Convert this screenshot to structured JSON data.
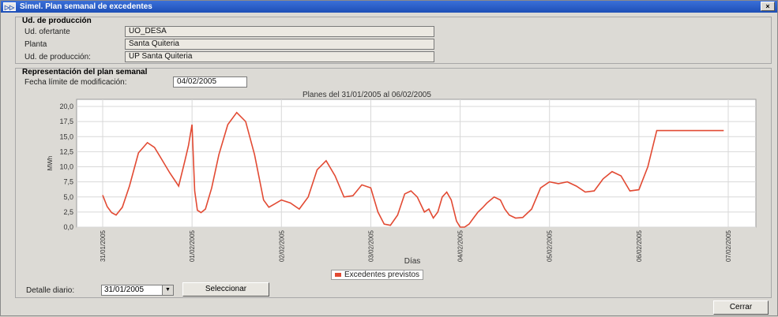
{
  "window": {
    "title": "Simel. Plan semanal de excedentes",
    "close_glyph": "×"
  },
  "unit_group": {
    "title": "Ud. de producción",
    "fields": [
      {
        "label": "Ud. ofertante",
        "value": "UO_DESA"
      },
      {
        "label": "Planta",
        "value": "Santa Quiteria"
      },
      {
        "label": "Ud. de producción:",
        "value": "UP Santa Quiteria"
      }
    ]
  },
  "plan_group": {
    "title": "Representación del plan semanal",
    "deadline_label": "Fecha límite de modificación:",
    "deadline_value": "04/02/2005"
  },
  "chart_data": {
    "type": "line",
    "title": "Planes del 31/01/2005 al 06/02/2005",
    "xlabel": "Días",
    "ylabel": "MWh",
    "ylim": [
      0,
      20
    ],
    "yticks": [
      "0,0",
      "2,5",
      "5,0",
      "7,5",
      "10,0",
      "12,5",
      "15,0",
      "17,5",
      "20,0"
    ],
    "xtick_labels": [
      "31/01/2005",
      "01/02/2005",
      "02/02/2005",
      "03/02/2005",
      "04/02/2005",
      "05/02/2005",
      "06/02/2005",
      "07/02/2005"
    ],
    "xlim": [
      0,
      7
    ],
    "grid": true,
    "legend_position": "bottom-center",
    "series": [
      {
        "name": "Excedentes previstos",
        "color": "#e24a33",
        "x": [
          0.0,
          0.05,
          0.1,
          0.15,
          0.22,
          0.3,
          0.4,
          0.5,
          0.58,
          0.65,
          0.75,
          0.85,
          0.92,
          0.96,
          1.0,
          1.03,
          1.06,
          1.1,
          1.15,
          1.22,
          1.3,
          1.4,
          1.5,
          1.6,
          1.7,
          1.8,
          1.86,
          1.92,
          2.0,
          2.1,
          2.2,
          2.3,
          2.4,
          2.5,
          2.6,
          2.7,
          2.8,
          2.9,
          3.0,
          3.08,
          3.15,
          3.22,
          3.3,
          3.38,
          3.45,
          3.52,
          3.6,
          3.65,
          3.7,
          3.75,
          3.8,
          3.85,
          3.9,
          3.96,
          4.0,
          4.02,
          4.05,
          4.1,
          4.15,
          4.2,
          4.25,
          4.3,
          4.38,
          4.45,
          4.5,
          4.55,
          4.62,
          4.7,
          4.8,
          4.9,
          5.0,
          5.1,
          5.2,
          5.3,
          5.4,
          5.5,
          5.6,
          5.7,
          5.8,
          5.9,
          6.0,
          6.1,
          6.2,
          6.3,
          6.4,
          6.5,
          6.6,
          6.7,
          6.8,
          6.9,
          6.95
        ],
        "y": [
          5.3,
          3.4,
          2.4,
          2.0,
          3.3,
          6.8,
          12.3,
          14.0,
          13.2,
          11.5,
          9.0,
          6.8,
          11.0,
          13.5,
          17.0,
          6.0,
          2.8,
          2.4,
          3.0,
          6.5,
          12.0,
          17.0,
          19.0,
          17.5,
          12.0,
          4.5,
          3.3,
          3.8,
          4.5,
          4.0,
          3.0,
          5.0,
          9.5,
          11.0,
          8.5,
          5.0,
          5.2,
          7.0,
          6.5,
          2.5,
          0.5,
          0.3,
          2.0,
          5.5,
          6.0,
          5.0,
          2.5,
          3.0,
          1.5,
          2.5,
          5.0,
          5.8,
          4.5,
          1.0,
          0.0,
          0.0,
          0.0,
          0.5,
          1.5,
          2.5,
          3.2,
          4.0,
          5.0,
          4.5,
          3.0,
          2.0,
          1.5,
          1.6,
          3.0,
          6.5,
          7.5,
          7.2,
          7.5,
          6.8,
          5.8,
          6.0,
          8.0,
          9.2,
          8.5,
          6.0,
          6.2,
          10.0,
          16.0,
          16.0,
          16.0,
          16.0,
          16.0,
          16.0,
          16.0,
          16.0,
          16.0
        ]
      }
    ]
  },
  "bottom": {
    "daily_label": "Detalle diario:",
    "daily_value": "31/01/2005",
    "select_button": "Seleccionar",
    "close_button": "Cerrar"
  }
}
